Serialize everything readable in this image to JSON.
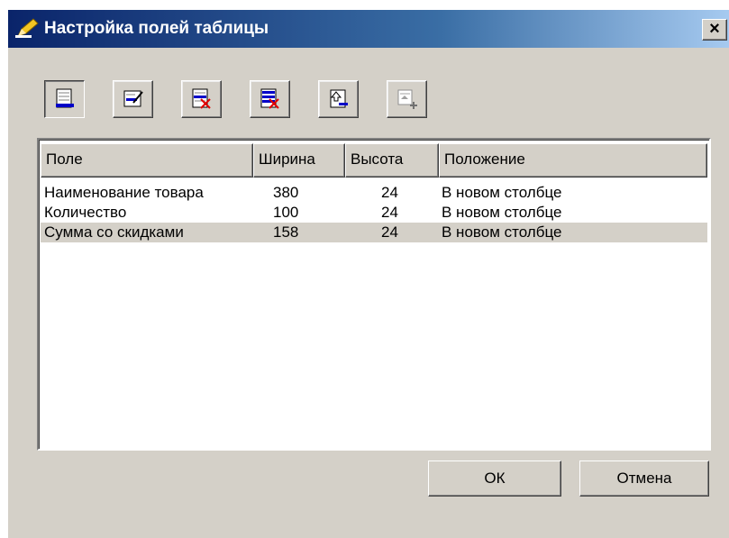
{
  "dialog": {
    "title": "Настройка полей таблицы",
    "close_label": "×"
  },
  "toolbar": {
    "buttons": [
      {
        "name": "add-field-button",
        "icon": "add-row-icon",
        "pressed": true
      },
      {
        "name": "edit-field-button",
        "icon": "edit-row-icon",
        "pressed": false
      },
      {
        "name": "delete-field-button",
        "icon": "delete-row-icon",
        "pressed": false
      },
      {
        "name": "delete-all-fields-button",
        "icon": "delete-all-rows-icon",
        "pressed": false
      },
      {
        "name": "move-field-up-button",
        "icon": "move-up-icon",
        "pressed": false
      },
      {
        "name": "insert-field-button",
        "icon": "insert-row-icon",
        "pressed": false,
        "disabled": true
      }
    ]
  },
  "table": {
    "columns": [
      "Поле",
      "Ширина",
      "Высота",
      "Положение"
    ],
    "rows": [
      {
        "field": "Наименование товара",
        "width": "380",
        "height": "24",
        "position": "В новом столбце",
        "selected": false
      },
      {
        "field": "Количество",
        "width": "100",
        "height": "24",
        "position": "В новом столбце",
        "selected": false
      },
      {
        "field": "Сумма со скидками",
        "width": "158",
        "height": "24",
        "position": "В новом столбце",
        "selected": true
      }
    ]
  },
  "buttons": {
    "ok": "ОК",
    "cancel": "Отмена"
  },
  "colors": {
    "titlebar_start": "#0a246a",
    "titlebar_end": "#a6caf0",
    "window_bg": "#d4d0c8",
    "icon_blue": "#0000c8",
    "icon_red": "#e00000"
  }
}
